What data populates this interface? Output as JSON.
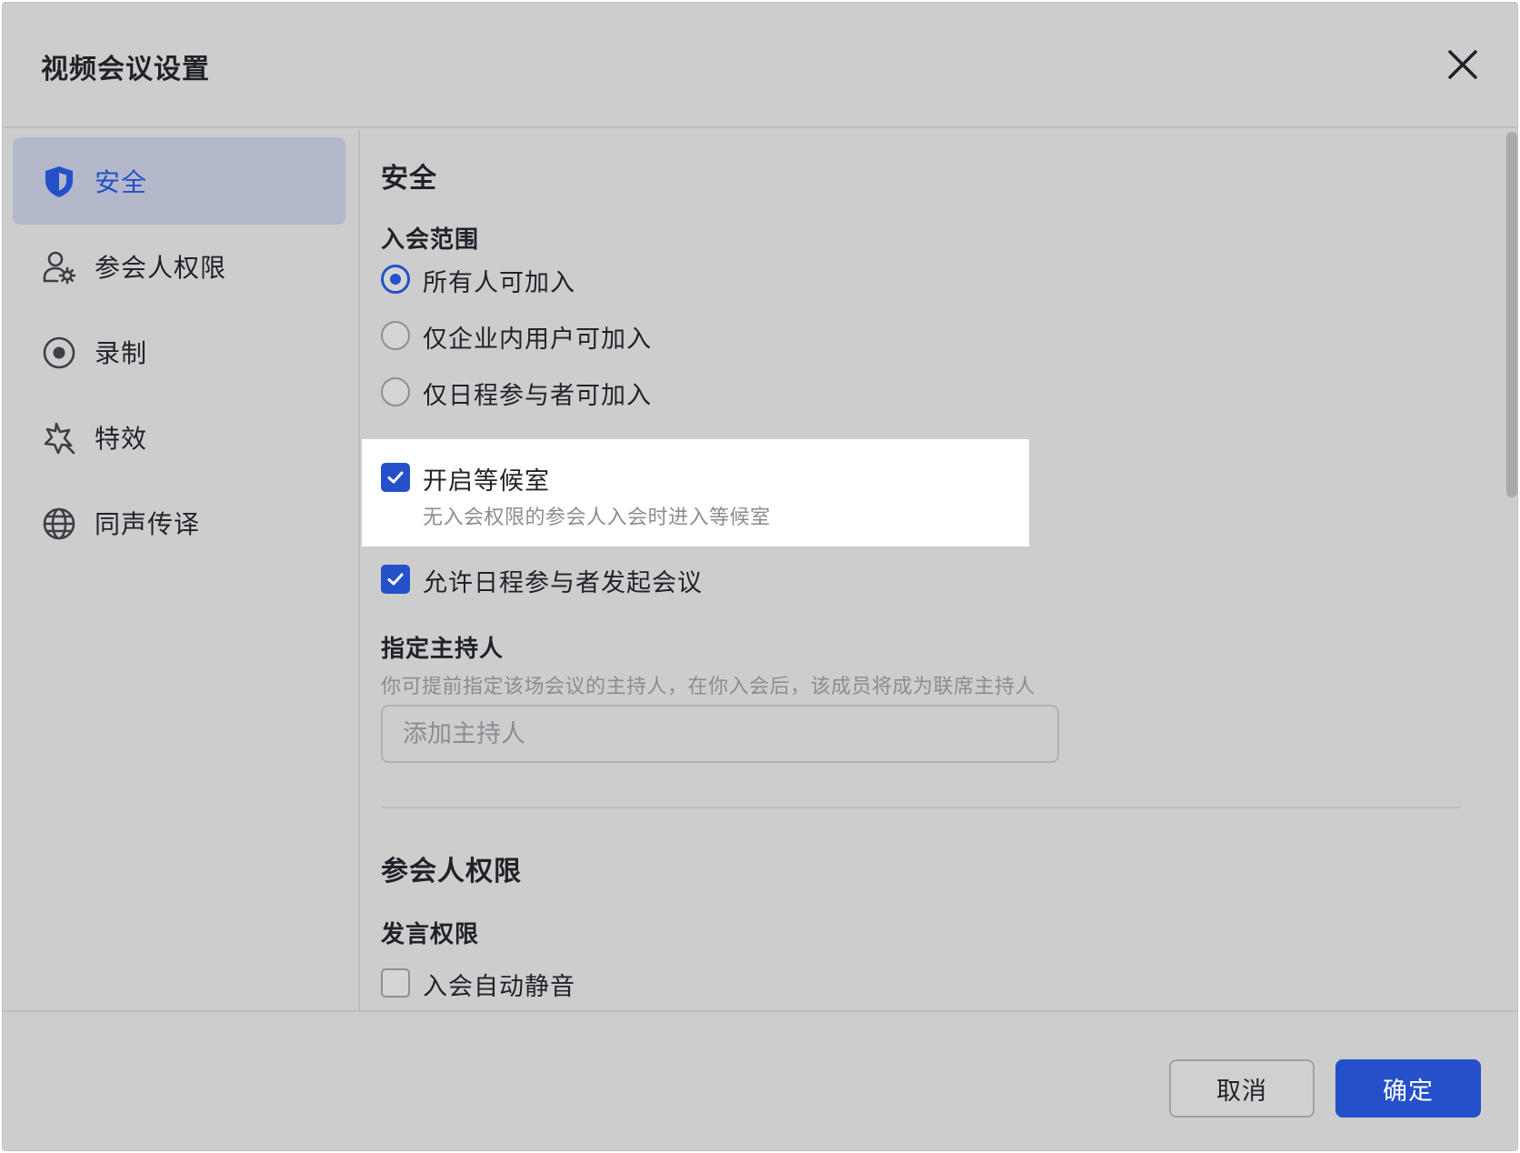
{
  "dialog": {
    "title": "视频会议设置",
    "close_icon": "close-icon"
  },
  "sidebar": {
    "items": [
      {
        "label": "安全",
        "icon": "shield-icon",
        "active": true
      },
      {
        "label": "参会人权限",
        "icon": "user-settings-icon",
        "active": false
      },
      {
        "label": "录制",
        "icon": "record-icon",
        "active": false
      },
      {
        "label": "特效",
        "icon": "sparkle-icon",
        "active": false
      },
      {
        "label": "同声传译",
        "icon": "globe-icon",
        "active": false
      }
    ]
  },
  "security": {
    "heading": "安全",
    "join_scope": {
      "label": "入会范围",
      "options": [
        {
          "label": "所有人可加入",
          "selected": true
        },
        {
          "label": "仅企业内用户可加入",
          "selected": false
        },
        {
          "label": "仅日程参与者可加入",
          "selected": false
        }
      ]
    },
    "waiting_room": {
      "label": "开启等候室",
      "description": "无入会权限的参会人入会时进入等候室",
      "checked": true
    },
    "allow_start": {
      "label": "允许日程参与者发起会议",
      "checked": true
    },
    "host": {
      "label": "指定主持人",
      "description": "你可提前指定该场会议的主持人，在你入会后，该成员将成为联席主持人",
      "placeholder": "添加主持人"
    }
  },
  "participant_permissions": {
    "heading": "参会人权限",
    "speaking": {
      "label": "发言权限",
      "mute_on_join": {
        "label": "入会自动静音",
        "checked": false
      }
    }
  },
  "footer": {
    "cancel_label": "取消",
    "ok_label": "确定"
  },
  "colors": {
    "accent": "#2451c9",
    "dialog_bg": "#cdcdcd",
    "active_nav_bg": "#b3b8cb"
  }
}
